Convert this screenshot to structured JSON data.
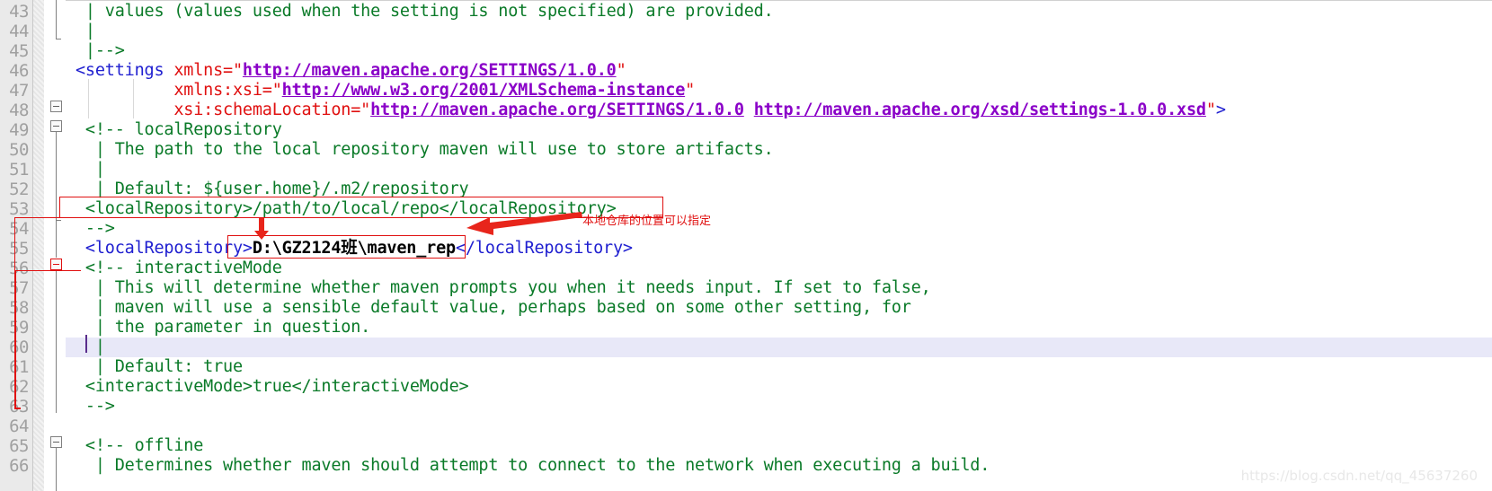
{
  "editor": {
    "file_type": "xml",
    "first_line_number": 43,
    "current_line_number": 60,
    "colors": {
      "comment": "#0a7a28",
      "tag": "#2020d0",
      "attribute": "#e01010",
      "url": "#8a00c8",
      "value": "#000000",
      "annotation": "#e01010",
      "gutter_bg": "#eaeaea",
      "current_line_bg": "#e8e8f8",
      "background": "#ffffff"
    }
  },
  "line_numbers": [
    "43",
    "44",
    "45",
    "46",
    "47",
    "48",
    "49",
    "50",
    "51",
    "52",
    "53",
    "54",
    "55",
    "56",
    "57",
    "58",
    "59",
    "60",
    "61",
    "62",
    "63",
    "64",
    "65",
    "66"
  ],
  "lines": [
    {
      "n": "43",
      "indent": 0,
      "tokens": [
        {
          "t": "comment",
          "s": "  | values (values used when the setting is not specified) are provided."
        }
      ]
    },
    {
      "n": "44",
      "indent": 0,
      "tokens": [
        {
          "t": "comment",
          "s": "  |"
        }
      ]
    },
    {
      "n": "45",
      "indent": 0,
      "tokens": [
        {
          "t": "comment",
          "s": "  |-->"
        }
      ]
    },
    {
      "n": "46",
      "indent": 0,
      "tokens": [
        {
          "t": "tag",
          "s": " <settings "
        },
        {
          "t": "attr",
          "s": "xmlns="
        },
        {
          "t": "quote",
          "s": "\""
        },
        {
          "t": "url",
          "s": "http://maven.apache.org/SETTINGS/1.0.0"
        },
        {
          "t": "quote",
          "s": "\""
        }
      ]
    },
    {
      "n": "47",
      "indent": 0,
      "tokens": [
        {
          "t": "plain",
          "s": "           "
        },
        {
          "t": "attr",
          "s": "xmlns:xsi="
        },
        {
          "t": "quote",
          "s": "\""
        },
        {
          "t": "url",
          "s": "http://www.w3.org/2001/XMLSchema-instance"
        },
        {
          "t": "quote",
          "s": "\""
        }
      ]
    },
    {
      "n": "48",
      "indent": 0,
      "tokens": [
        {
          "t": "plain",
          "s": "           "
        },
        {
          "t": "attr",
          "s": "xsi:schemaLocation="
        },
        {
          "t": "quote",
          "s": "\""
        },
        {
          "t": "url",
          "s": "http://maven.apache.org/SETTINGS/1.0.0"
        },
        {
          "t": "plain",
          "s": " "
        },
        {
          "t": "url",
          "s": "http://maven.apache.org/xsd/settings-1.0.0.xsd"
        },
        {
          "t": "quote",
          "s": "\""
        },
        {
          "t": "tag",
          "s": ">"
        }
      ]
    },
    {
      "n": "49",
      "indent": 0,
      "tokens": [
        {
          "t": "comment",
          "s": "  <!-- localRepository"
        }
      ]
    },
    {
      "n": "50",
      "indent": 0,
      "tokens": [
        {
          "t": "comment",
          "s": "   | The path to the local repository maven will use to store artifacts."
        }
      ]
    },
    {
      "n": "51",
      "indent": 0,
      "tokens": [
        {
          "t": "comment",
          "s": "   |"
        }
      ]
    },
    {
      "n": "52",
      "indent": 0,
      "tokens": [
        {
          "t": "comment",
          "s": "   | Default: ${user.home}/.m2/repository"
        }
      ]
    },
    {
      "n": "53",
      "indent": 0,
      "tokens": [
        {
          "t": "comment",
          "s": "  <localRepository>/path/to/local/repo</localRepository>"
        }
      ]
    },
    {
      "n": "54",
      "indent": 0,
      "tokens": [
        {
          "t": "comment",
          "s": "  -->"
        }
      ]
    },
    {
      "n": "55",
      "indent": 0,
      "tokens": [
        {
          "t": "tag",
          "s": "  <localRepository>"
        },
        {
          "t": "value",
          "s": "D:\\GZ2124班\\maven_rep"
        },
        {
          "t": "tag",
          "s": "</localRepository>"
        }
      ]
    },
    {
      "n": "56",
      "indent": 0,
      "tokens": [
        {
          "t": "comment",
          "s": "  <!-- interactiveMode"
        }
      ]
    },
    {
      "n": "57",
      "indent": 0,
      "tokens": [
        {
          "t": "comment",
          "s": "   | This will determine whether maven prompts you when it needs input. If set to false,"
        }
      ]
    },
    {
      "n": "58",
      "indent": 0,
      "tokens": [
        {
          "t": "comment",
          "s": "   | maven will use a sensible default value, perhaps based on some other setting, for"
        }
      ]
    },
    {
      "n": "59",
      "indent": 0,
      "tokens": [
        {
          "t": "comment",
          "s": "   | the parameter in question."
        }
      ]
    },
    {
      "n": "60",
      "indent": 0,
      "tokens": [
        {
          "t": "comment",
          "s": "   |"
        }
      ]
    },
    {
      "n": "61",
      "indent": 0,
      "tokens": [
        {
          "t": "comment",
          "s": "   | Default: true"
        }
      ]
    },
    {
      "n": "62",
      "indent": 0,
      "tokens": [
        {
          "t": "comment",
          "s": "  <interactiveMode>true</interactiveMode>"
        }
      ]
    },
    {
      "n": "63",
      "indent": 0,
      "tokens": [
        {
          "t": "comment",
          "s": "  -->"
        }
      ]
    },
    {
      "n": "64",
      "indent": 0,
      "tokens": [
        {
          "t": "plain",
          "s": ""
        }
      ]
    },
    {
      "n": "65",
      "indent": 0,
      "tokens": [
        {
          "t": "comment",
          "s": "  <!-- offline"
        }
      ]
    },
    {
      "n": "66",
      "indent": 0,
      "tokens": [
        {
          "t": "comment",
          "s": "   | Determines whether maven should attempt to connect to the network when executing a build."
        }
      ]
    }
  ],
  "annotations": {
    "commented_repo_box_label": "commented-localRepository-highlight",
    "active_repo_box_label": "active-localRepository-value-highlight",
    "note_text": "本地仓库的位置可以指定",
    "down_arrow_label": "down-arrow",
    "left_arrow_label": "left-arrow"
  },
  "watermark": {
    "text": "https://blog.csdn.net/qq_45637260"
  }
}
